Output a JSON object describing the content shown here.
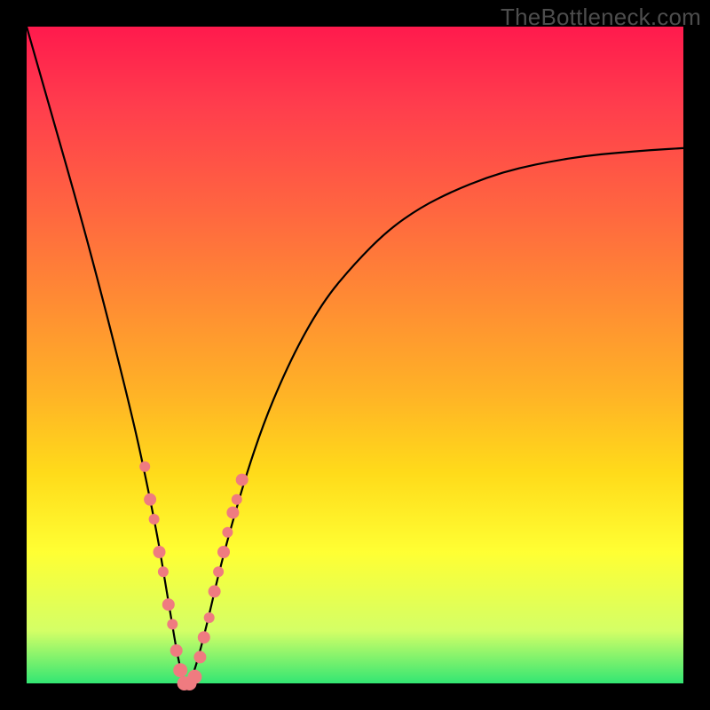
{
  "watermark": "TheBottleneck.com",
  "colors": {
    "frame": "#000000",
    "gradient_top": "#ff1a4d",
    "gradient_bottom": "#33e673",
    "curve": "#000000",
    "marker_fill": "#ef7b80",
    "marker_stroke": "#e25c65"
  },
  "chart_data": {
    "type": "line",
    "title": "",
    "xlabel": "",
    "ylabel": "",
    "xlim": [
      0,
      100
    ],
    "ylim": [
      0,
      100
    ],
    "grid": false,
    "legend": false,
    "series": [
      {
        "name": "bottleneck_curve",
        "x": [
          0,
          4,
          8,
          12,
          16,
          18,
          20,
          21,
          22,
          23,
          24,
          25,
          27,
          30,
          35,
          40,
          45,
          50,
          55,
          60,
          65,
          70,
          75,
          80,
          85,
          90,
          95,
          100
        ],
        "y": [
          100,
          86,
          72,
          57,
          41,
          32,
          22,
          16,
          10,
          4,
          0,
          0,
          7,
          20,
          37,
          49,
          58,
          64,
          69,
          72.5,
          75,
          77,
          78.5,
          79.5,
          80.3,
          80.8,
          81.2,
          81.5
        ]
      }
    ],
    "markers": [
      {
        "x": 18.0,
        "y": 33,
        "size": 6
      },
      {
        "x": 18.8,
        "y": 28,
        "size": 7
      },
      {
        "x": 19.4,
        "y": 25,
        "size": 6
      },
      {
        "x": 20.2,
        "y": 20,
        "size": 7
      },
      {
        "x": 20.8,
        "y": 17,
        "size": 6
      },
      {
        "x": 21.6,
        "y": 12,
        "size": 7
      },
      {
        "x": 22.2,
        "y": 9,
        "size": 6
      },
      {
        "x": 22.8,
        "y": 5,
        "size": 7
      },
      {
        "x": 23.4,
        "y": 2,
        "size": 8
      },
      {
        "x": 24.0,
        "y": 0,
        "size": 8
      },
      {
        "x": 24.8,
        "y": 0,
        "size": 8
      },
      {
        "x": 25.6,
        "y": 1,
        "size": 8
      },
      {
        "x": 26.4,
        "y": 4,
        "size": 7
      },
      {
        "x": 27.0,
        "y": 7,
        "size": 7
      },
      {
        "x": 27.8,
        "y": 10,
        "size": 6
      },
      {
        "x": 28.6,
        "y": 14,
        "size": 7
      },
      {
        "x": 29.2,
        "y": 17,
        "size": 6
      },
      {
        "x": 30.0,
        "y": 20,
        "size": 7
      },
      {
        "x": 30.6,
        "y": 23,
        "size": 6
      },
      {
        "x": 31.4,
        "y": 26,
        "size": 7
      },
      {
        "x": 32.0,
        "y": 28,
        "size": 6
      },
      {
        "x": 32.8,
        "y": 31,
        "size": 7
      }
    ]
  }
}
